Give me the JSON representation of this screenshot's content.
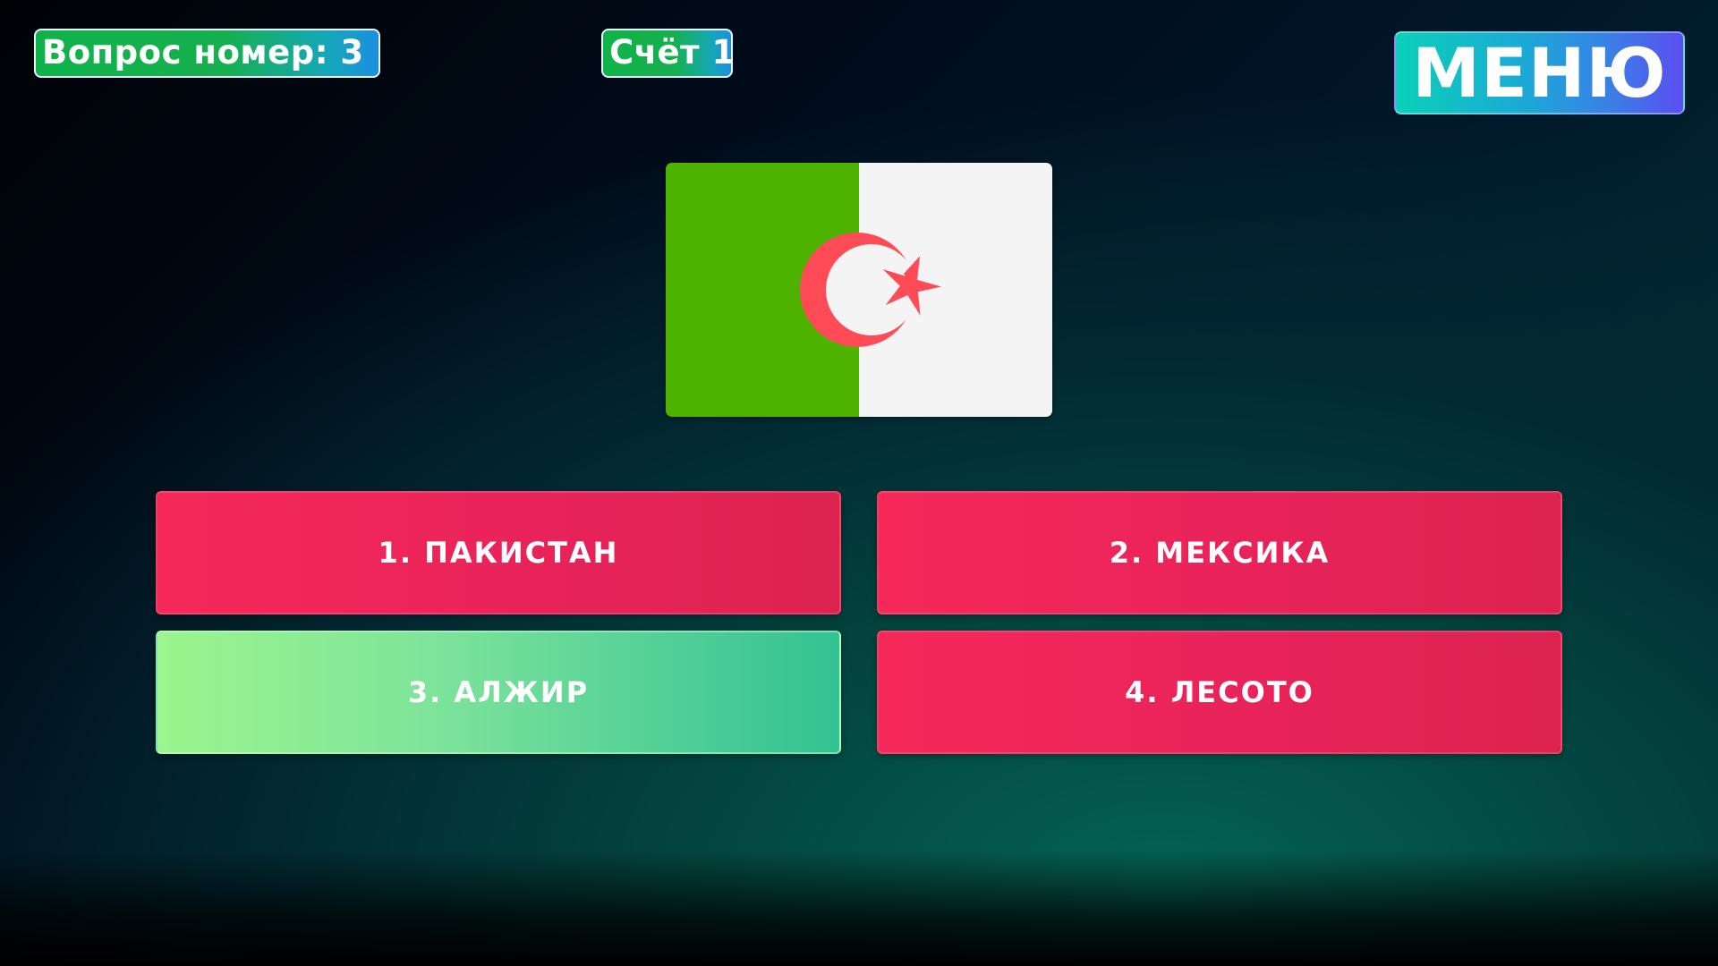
{
  "header": {
    "question_label": "Вопрос номер: 3",
    "score_label": "Счёт 1",
    "menu_label": "МЕНЮ"
  },
  "flag": {
    "icon": "algeria-flag-icon",
    "colors": {
      "left": "#4db300",
      "right": "#f4f4f4",
      "emblem": "#ff4b55"
    }
  },
  "answers": [
    {
      "label": "1. ПАКИСТАН",
      "state": "wrong"
    },
    {
      "label": "2. МЕКСИКА",
      "state": "wrong"
    },
    {
      "label": "3. АЛЖИР",
      "state": "correct"
    },
    {
      "label": "4. ЛЕСОТО",
      "state": "wrong"
    }
  ],
  "colors": {
    "wrong": "#f2285a",
    "correct": "#7ee49a",
    "menu_accent": "#1ba9d6",
    "pill_green": "#0fb24a"
  }
}
